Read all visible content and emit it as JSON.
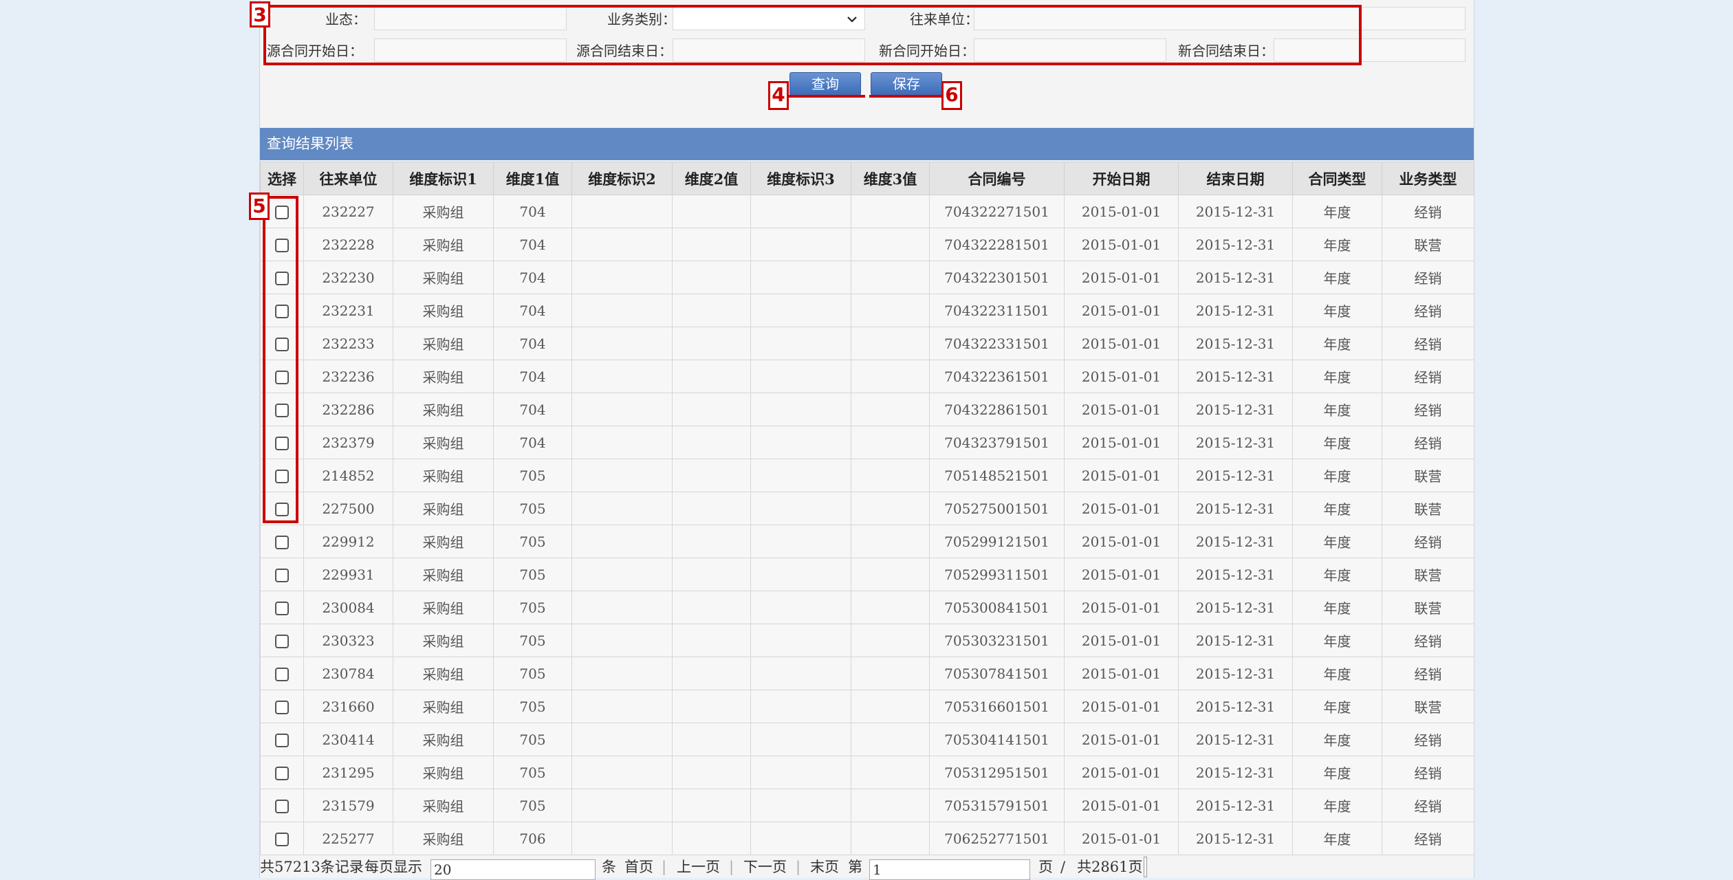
{
  "form": {
    "row1": [
      {
        "label": "业态：",
        "value": ""
      },
      {
        "label": "业务类别：",
        "value": ""
      },
      {
        "label": "往来单位：",
        "value": ""
      }
    ],
    "row2": [
      {
        "label": "源合同开始日：",
        "value": ""
      },
      {
        "label": "源合同结束日：",
        "value": ""
      },
      {
        "label": "新合同开始日：",
        "value": ""
      },
      {
        "label": "新合同结束日：",
        "value": ""
      }
    ]
  },
  "buttons": {
    "query": "查询",
    "save": "保存"
  },
  "section_title": "查询结果列表",
  "table": {
    "headers": [
      "选择",
      "往来单位",
      "维度标识1",
      "维度1值",
      "维度标识2",
      "维度2值",
      "维度标识3",
      "维度3值",
      "合同编号",
      "开始日期",
      "结束日期",
      "合同类型",
      "业务类型"
    ],
    "rows": [
      [
        "232227",
        "采购组",
        "704",
        "",
        "",
        "",
        "",
        "704322271501",
        "2015-01-01",
        "2015-12-31",
        "年度",
        "经销"
      ],
      [
        "232228",
        "采购组",
        "704",
        "",
        "",
        "",
        "",
        "704322281501",
        "2015-01-01",
        "2015-12-31",
        "年度",
        "联营"
      ],
      [
        "232230",
        "采购组",
        "704",
        "",
        "",
        "",
        "",
        "704322301501",
        "2015-01-01",
        "2015-12-31",
        "年度",
        "经销"
      ],
      [
        "232231",
        "采购组",
        "704",
        "",
        "",
        "",
        "",
        "704322311501",
        "2015-01-01",
        "2015-12-31",
        "年度",
        "经销"
      ],
      [
        "232233",
        "采购组",
        "704",
        "",
        "",
        "",
        "",
        "704322331501",
        "2015-01-01",
        "2015-12-31",
        "年度",
        "经销"
      ],
      [
        "232236",
        "采购组",
        "704",
        "",
        "",
        "",
        "",
        "704322361501",
        "2015-01-01",
        "2015-12-31",
        "年度",
        "经销"
      ],
      [
        "232286",
        "采购组",
        "704",
        "",
        "",
        "",
        "",
        "704322861501",
        "2015-01-01",
        "2015-12-31",
        "年度",
        "经销"
      ],
      [
        "232379",
        "采购组",
        "704",
        "",
        "",
        "",
        "",
        "704323791501",
        "2015-01-01",
        "2015-12-31",
        "年度",
        "经销"
      ],
      [
        "214852",
        "采购组",
        "705",
        "",
        "",
        "",
        "",
        "705148521501",
        "2015-01-01",
        "2015-12-31",
        "年度",
        "联营"
      ],
      [
        "227500",
        "采购组",
        "705",
        "",
        "",
        "",
        "",
        "705275001501",
        "2015-01-01",
        "2015-12-31",
        "年度",
        "联营"
      ],
      [
        "229912",
        "采购组",
        "705",
        "",
        "",
        "",
        "",
        "705299121501",
        "2015-01-01",
        "2015-12-31",
        "年度",
        "经销"
      ],
      [
        "229931",
        "采购组",
        "705",
        "",
        "",
        "",
        "",
        "705299311501",
        "2015-01-01",
        "2015-12-31",
        "年度",
        "联营"
      ],
      [
        "230084",
        "采购组",
        "705",
        "",
        "",
        "",
        "",
        "705300841501",
        "2015-01-01",
        "2015-12-31",
        "年度",
        "联营"
      ],
      [
        "230323",
        "采购组",
        "705",
        "",
        "",
        "",
        "",
        "705303231501",
        "2015-01-01",
        "2015-12-31",
        "年度",
        "经销"
      ],
      [
        "230784",
        "采购组",
        "705",
        "",
        "",
        "",
        "",
        "705307841501",
        "2015-01-01",
        "2015-12-31",
        "年度",
        "经销"
      ],
      [
        "231660",
        "采购组",
        "705",
        "",
        "",
        "",
        "",
        "705316601501",
        "2015-01-01",
        "2015-12-31",
        "年度",
        "联营"
      ],
      [
        "230414",
        "采购组",
        "705",
        "",
        "",
        "",
        "",
        "705304141501",
        "2015-01-01",
        "2015-12-31",
        "年度",
        "经销"
      ],
      [
        "231295",
        "采购组",
        "705",
        "",
        "",
        "",
        "",
        "705312951501",
        "2015-01-01",
        "2015-12-31",
        "年度",
        "经销"
      ],
      [
        "231579",
        "采购组",
        "705",
        "",
        "",
        "",
        "",
        "705315791501",
        "2015-01-01",
        "2015-12-31",
        "年度",
        "经销"
      ],
      [
        "225277",
        "采购组",
        "706",
        "",
        "",
        "",
        "",
        "706252771501",
        "2015-01-01",
        "2015-12-31",
        "年度",
        "经销"
      ]
    ]
  },
  "pager": {
    "total": "共57213条记录",
    "per_page_label": "每页显示",
    "per_page_value": "20",
    "unit": "条",
    "first": "首页",
    "prev": "上一页",
    "next": "下一页",
    "last": "末页",
    "page_prefix": "第",
    "page_value": "1",
    "page_suffix": "页",
    "slash": "/",
    "total_pages": "共2861页",
    "divider": "|"
  },
  "annotations": {
    "a3": "3",
    "a4": "4",
    "a5": "5",
    "a6": "6"
  },
  "colors": {
    "header_bar": "#6189c4",
    "button": "#3b6cb8",
    "annotation": "#cc0000"
  }
}
